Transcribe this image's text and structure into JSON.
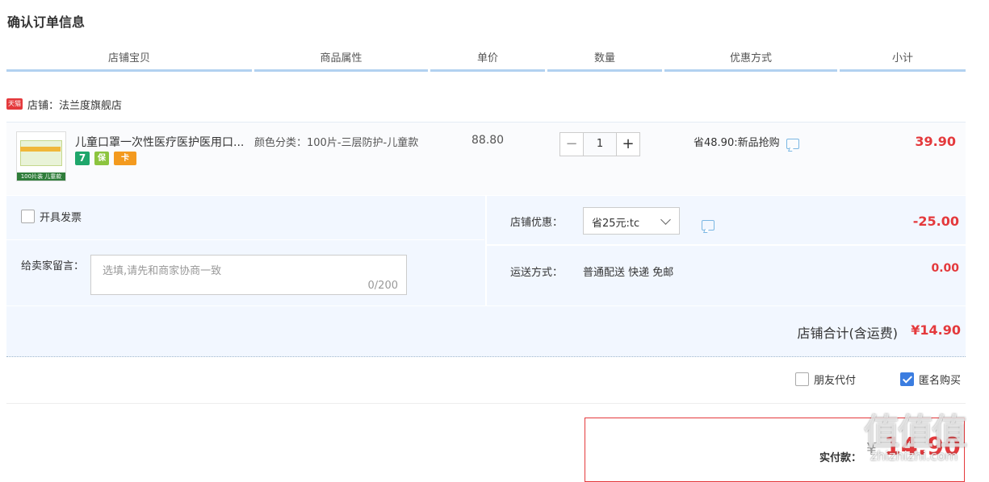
{
  "page_title": "确认订单信息",
  "table_headers": [
    "店铺宝贝",
    "商品属性",
    "单价",
    "数量",
    "优惠方式",
    "小计"
  ],
  "shop": {
    "badge": "天猫",
    "label": "店铺：法兰度旗舰店"
  },
  "item": {
    "thumb_tag": "100片装 儿童款",
    "title": "儿童口罩一次性医疗医护医用口...",
    "service_icons": [
      {
        "name": "seven-day-return-icon",
        "text": "7",
        "color": "#1ea66b"
      },
      {
        "name": "shield-guarantee-icon",
        "text": "保",
        "color": "#8cc43f"
      },
      {
        "name": "credit-card-icon",
        "text": "卡",
        "color": "#f39a1e"
      }
    ],
    "attribute": "颜色分类：100片-三层防护-儿童款",
    "unit_price": "88.80",
    "quantity": "1",
    "minus_symbol": "−",
    "plus_symbol": "+",
    "promotion": "省48.90:新品抢购",
    "subtotal": "39.90"
  },
  "invoice": {
    "label": "开具发票",
    "checked": false
  },
  "memo": {
    "label": "给卖家留言：",
    "placeholder": "选填,请先和商家协商一致",
    "count": "0/200"
  },
  "store_discount": {
    "label": "店铺优惠：",
    "selected": "省25元:tc",
    "value": "-25.00"
  },
  "shipping": {
    "label": "运送方式：",
    "method": "普通配送 快递 免邮",
    "price": "0.00"
  },
  "store_total": {
    "label": "店铺合计(含运费)",
    "value": "¥14.90"
  },
  "options": {
    "friend_pay": {
      "label": "朋友代付",
      "checked": false
    },
    "anonymous": {
      "label": "匿名购买",
      "checked": true
    }
  },
  "payment": {
    "label": "实付款：",
    "currency": "¥",
    "amount": "14.90"
  },
  "watermark": {
    "big": "值值值",
    "small": "zhizhizhi.com"
  },
  "colors": {
    "accent_red": "#e4393c",
    "header_line": "#b2d1f0",
    "panel_bg": "#f2f7ff",
    "checkbox_blue": "#3b7de0"
  }
}
